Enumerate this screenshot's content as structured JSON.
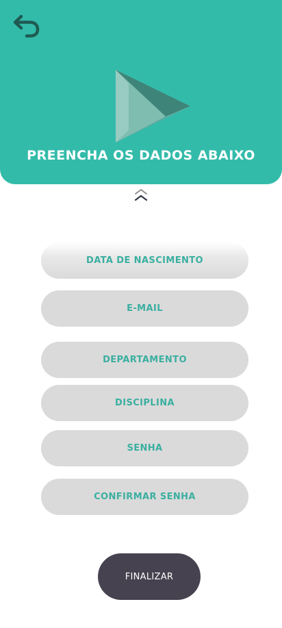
{
  "header": {
    "title": "PREENCHA OS DADOS ABAIXO",
    "background_color": "#33bbaa"
  },
  "form": {
    "fields": [
      {
        "placeholder": "DATA DE NASCIMENTO"
      },
      {
        "placeholder": "E-MAIL"
      },
      {
        "placeholder": "DEPARTAMENTO"
      },
      {
        "placeholder": "DISCIPLINA"
      },
      {
        "placeholder": "SENHA"
      },
      {
        "placeholder": "CONFIRMAR SENHA"
      }
    ],
    "field_background": "#dadada",
    "field_text_color": "#3aafa0"
  },
  "finish_button": {
    "label": "FINALIZAR",
    "background_color": "#47424f"
  },
  "icons": {
    "back": "undo-arrow-icon",
    "collapse": "double-chevron-up-icon",
    "logo": "play-triangle-logo"
  }
}
